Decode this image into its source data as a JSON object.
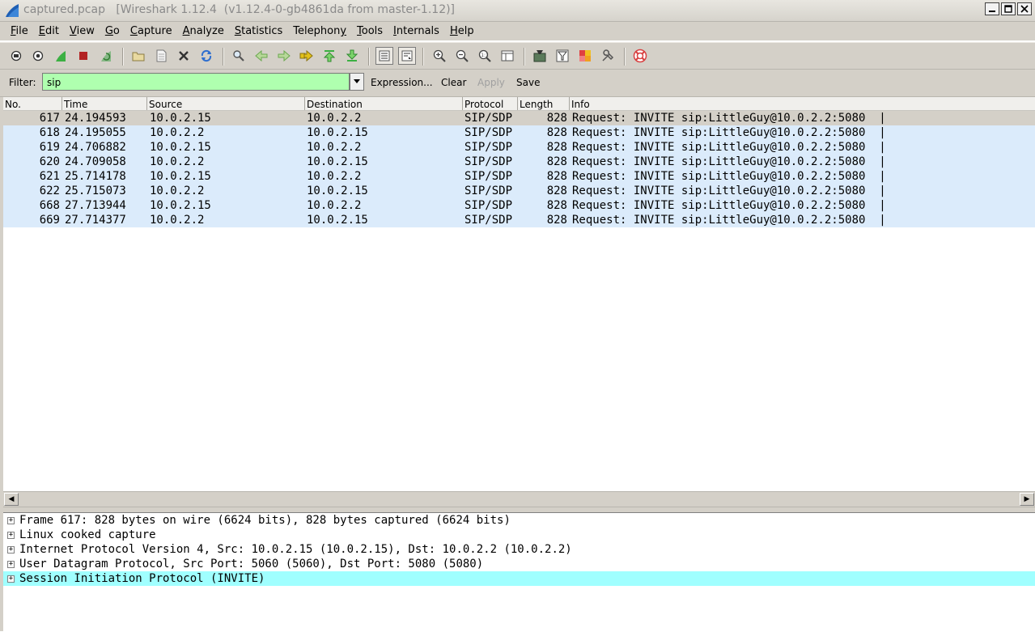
{
  "window": {
    "title": "captured.pcap   [Wireshark 1.12.4  (v1.12.4-0-gb4861da from master-1.12)]",
    "buttons": [
      "minimize-icon",
      "maximize-icon",
      "close-icon"
    ]
  },
  "menu": [
    {
      "label": "File",
      "accel": "F",
      "rest": "ile"
    },
    {
      "label": "Edit",
      "accel": "E",
      "rest": "dit"
    },
    {
      "label": "View",
      "accel": "V",
      "rest": "iew"
    },
    {
      "label": "Go",
      "accel": "G",
      "rest": "o"
    },
    {
      "label": "Capture",
      "accel": "C",
      "rest": "apture"
    },
    {
      "label": "Analyze",
      "accel": "A",
      "rest": "nalyze"
    },
    {
      "label": "Statistics",
      "accel": "S",
      "rest": "tatistics"
    },
    {
      "label": "Telephony",
      "accel": "",
      "pre": "Telephon",
      "accelEnd": "y"
    },
    {
      "label": "Tools",
      "accel": "T",
      "rest": "ools"
    },
    {
      "label": "Internals",
      "accel": "I",
      "rest": "nternals"
    },
    {
      "label": "Help",
      "accel": "H",
      "rest": "elp"
    }
  ],
  "toolbar": {
    "icons": [
      "interface-list-icon",
      "capture-options-icon",
      "start-capture-icon",
      "stop-capture-icon",
      "restart-capture-icon",
      "open-file-icon",
      "save-file-icon",
      "close-file-icon",
      "reload-icon",
      "find-packet-icon",
      "go-back-icon",
      "go-forward-icon",
      "go-to-packet-icon",
      "first-packet-icon",
      "last-packet-icon",
      "colorize-icon",
      "auto-scroll-icon",
      "zoom-in-icon",
      "zoom-out-icon",
      "normal-size-icon",
      "resize-columns-icon",
      "capture-filters-icon",
      "display-filters-icon",
      "coloring-rules-icon",
      "preferences-icon",
      "help-icon"
    ],
    "colors": {
      "start": "#3cb043",
      "stop": "#b22222",
      "arrows": "#6aa84f",
      "help": "#d84040"
    }
  },
  "filter": {
    "label": "Filter:",
    "value": "sip",
    "bg_color": "#afffaf",
    "expression": "Expression...",
    "clear": "Clear",
    "apply": "Apply",
    "save": "Save"
  },
  "packet_list": {
    "columns": [
      "No.",
      "Time",
      "Source",
      "Destination",
      "Protocol",
      "Length",
      "Info"
    ],
    "rows": [
      {
        "no": "617",
        "time": "24.194593",
        "src": "10.0.2.15",
        "dst": "10.0.2.2",
        "proto": "SIP/SDP",
        "len": "828",
        "info": "Request: INVITE sip:LittleGuy@10.0.2.2:5080  |",
        "selected": true
      },
      {
        "no": "618",
        "time": "24.195055",
        "src": "10.0.2.2",
        "dst": "10.0.2.15",
        "proto": "SIP/SDP",
        "len": "828",
        "info": "Request: INVITE sip:LittleGuy@10.0.2.2:5080  |"
      },
      {
        "no": "619",
        "time": "24.706882",
        "src": "10.0.2.15",
        "dst": "10.0.2.2",
        "proto": "SIP/SDP",
        "len": "828",
        "info": "Request: INVITE sip:LittleGuy@10.0.2.2:5080  |"
      },
      {
        "no": "620",
        "time": "24.709058",
        "src": "10.0.2.2",
        "dst": "10.0.2.15",
        "proto": "SIP/SDP",
        "len": "828",
        "info": "Request: INVITE sip:LittleGuy@10.0.2.2:5080  |"
      },
      {
        "no": "621",
        "time": "25.714178",
        "src": "10.0.2.15",
        "dst": "10.0.2.2",
        "proto": "SIP/SDP",
        "len": "828",
        "info": "Request: INVITE sip:LittleGuy@10.0.2.2:5080  |"
      },
      {
        "no": "622",
        "time": "25.715073",
        "src": "10.0.2.2",
        "dst": "10.0.2.15",
        "proto": "SIP/SDP",
        "len": "828",
        "info": "Request: INVITE sip:LittleGuy@10.0.2.2:5080  |"
      },
      {
        "no": "668",
        "time": "27.713944",
        "src": "10.0.2.15",
        "dst": "10.0.2.2",
        "proto": "SIP/SDP",
        "len": "828",
        "info": "Request: INVITE sip:LittleGuy@10.0.2.2:5080  |"
      },
      {
        "no": "669",
        "time": "27.714377",
        "src": "10.0.2.2",
        "dst": "10.0.2.15",
        "proto": "SIP/SDP",
        "len": "828",
        "info": "Request: INVITE sip:LittleGuy@10.0.2.2:5080  |"
      }
    ],
    "row_color": "#dbebfb",
    "selected_color": "#d4d0c8"
  },
  "details": {
    "rows": [
      {
        "text": "Frame 617: 828 bytes on wire (6624 bits), 828 bytes captured (6624 bits)"
      },
      {
        "text": "Linux cooked capture"
      },
      {
        "text": "Internet Protocol Version 4, Src: 10.0.2.15 (10.0.2.15), Dst: 10.0.2.2 (10.0.2.2)"
      },
      {
        "text": "User Datagram Protocol, Src Port: 5060 (5060), Dst Port: 5080 (5080)"
      },
      {
        "text": "Session Initiation Protocol (INVITE)",
        "highlight": true
      }
    ],
    "expander": "+",
    "highlight_color": "#a0ffff"
  }
}
